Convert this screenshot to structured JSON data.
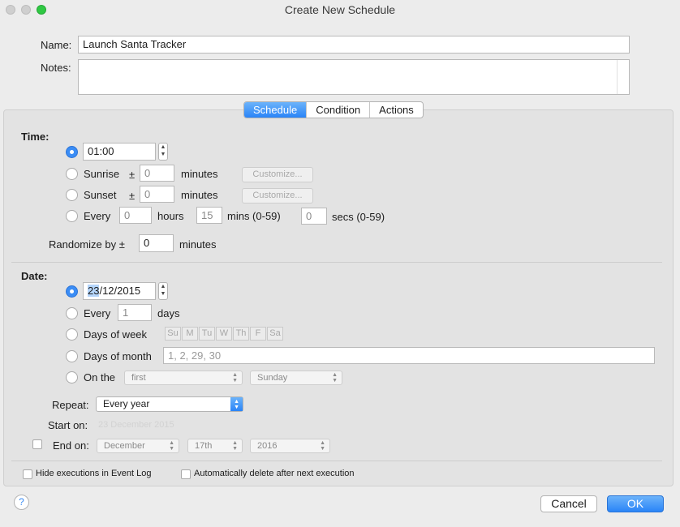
{
  "window": {
    "title": "Create New Schedule"
  },
  "name_field": {
    "label": "Name:",
    "value": "Launch Santa Tracker"
  },
  "notes_field": {
    "label": "Notes:",
    "value": ""
  },
  "tabs": [
    {
      "label": "Schedule",
      "selected": true
    },
    {
      "label": "Condition",
      "selected": false
    },
    {
      "label": "Actions",
      "selected": false
    }
  ],
  "time": {
    "heading": "Time:",
    "value": "01:00",
    "sunrise": {
      "label": "Sunrise",
      "pm": "±",
      "value": "0",
      "unit": "minutes",
      "customize": "Customize..."
    },
    "sunset": {
      "label": "Sunset",
      "pm": "±",
      "value": "0",
      "unit": "minutes",
      "customize": "Customize..."
    },
    "every": {
      "label": "Every",
      "hours": "0",
      "hours_label": "hours",
      "mins": "15",
      "mins_label": "mins (0-59)",
      "secs": "0",
      "secs_label": "secs (0-59)"
    },
    "randomize": {
      "label": "Randomize by ±",
      "value": "0",
      "unit": "minutes"
    }
  },
  "date": {
    "heading": "Date:",
    "value_selected": "23",
    "value_rest": "/12/2015",
    "every": {
      "label": "Every",
      "value": "1",
      "unit": "days"
    },
    "days_of_week": {
      "label": "Days of week",
      "days": [
        "Su",
        "M",
        "Tu",
        "W",
        "Th",
        "F",
        "Sa"
      ]
    },
    "days_of_month": {
      "label": "Days of month",
      "placeholder": "1, 2, 29, 30"
    },
    "on_the": {
      "label": "On the",
      "ordinal": "first",
      "weekday": "Sunday"
    },
    "repeat": {
      "label": "Repeat:",
      "value": "Every year"
    },
    "start_on": {
      "label": "Start on:",
      "value": "23 December 2015"
    },
    "end_on": {
      "label": "End on:",
      "month": "December",
      "day": "17th",
      "year": "2016"
    }
  },
  "options": {
    "hide_executions": "Hide executions in Event Log",
    "auto_delete": "Automatically delete after next execution"
  },
  "footer": {
    "help": "?",
    "cancel": "Cancel",
    "ok": "OK"
  },
  "colors": {
    "accent": "#3b8df5",
    "background": "#ececec"
  }
}
